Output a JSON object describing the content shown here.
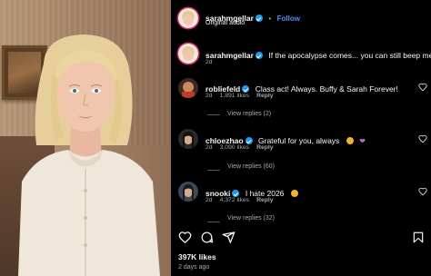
{
  "post": {
    "author": "sarahmgellar",
    "follow_label": "Follow",
    "dot": "•",
    "audio": "Original audio"
  },
  "caption": {
    "author": "sarahmgellar",
    "text": "If the apocalypse comes... you can still beep me",
    "time": "2d"
  },
  "comments": [
    {
      "author": "robliefeld",
      "text": "Class act! Always. Buffy & Sarah Forever!",
      "time": "2d",
      "likes": "1,891 likes",
      "reply": "Reply",
      "view_replies": "View replies (2)",
      "emoji_color": ""
    },
    {
      "author": "chloezhao",
      "text": "Grateful for you, always",
      "time": "2d",
      "likes": "3,090 likes",
      "reply": "Reply",
      "view_replies": "View replies (60)",
      "emoji_color": "#f0b429"
    },
    {
      "author": "snooki",
      "text": "I hate 2026",
      "time": "2d",
      "likes": "4,372 likes",
      "reply": "Reply",
      "view_replies": "View replies (32)",
      "emoji_color": "#f0b429"
    }
  ],
  "footer": {
    "likes": "397K likes",
    "posted": "2 days ago"
  },
  "icons": {
    "like": "heart-icon",
    "comment": "comment-icon",
    "share": "share-icon",
    "save": "bookmark-icon"
  }
}
